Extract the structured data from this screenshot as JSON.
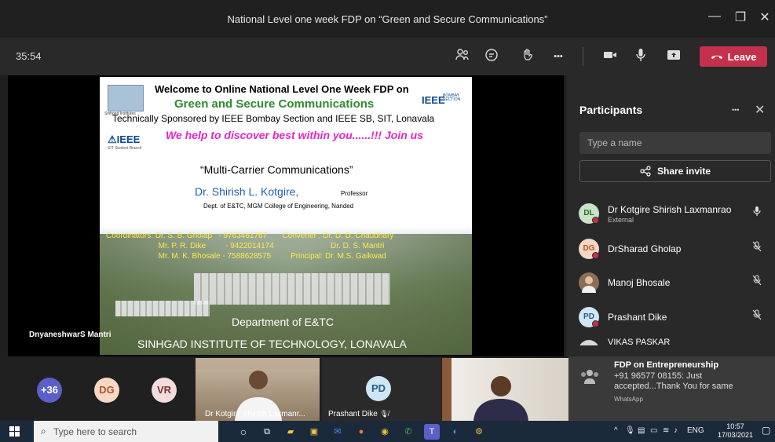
{
  "window": {
    "title": "National Level one week FDP on “Green and Secure Communications”",
    "minimize_glyph": "—",
    "maximize_glyph": "❐",
    "close_glyph": "✕"
  },
  "toolbar": {
    "timer": "35:54",
    "leave_label": "Leave",
    "more_glyph": "•••"
  },
  "slide": {
    "welcome": "Welcome to Online National Level One Week FDP on",
    "green_secure": "Green and Secure Communications",
    "sponsor": "Technically Sponsored by IEEE Bombay Section and IEEE SB, SIT, Lonavala",
    "tagline": "We help to discover best within you......!!!  Join us",
    "talk_title": "“Multi-Carrier Communications”",
    "speaker": "Dr. Shirish L. Kotgire,",
    "speaker_role": "Professor",
    "speaker_dept": "Dept. of E&TC, MGM College of Engineering, Nanded",
    "coordinators_line1": "Coordinators: Dr. S. B. Gholap   - 9763461767       Convener : Dr. D. D. Chaudhary",
    "coordinators_line2": "                        Mr. P. R. Dike         - 9422014174                          Dr. D. S. Mantri",
    "coordinators_line3": "                        Mr. M. K. Bhosale - 7588628575         Principal: Dr. M.S. Gaikwad",
    "department": "Department of E&TC",
    "institute": "SINHGAD  INSTITUTE OF TECHNOLOGY, LONAVALA",
    "logo_caption": "Sinhgad Institutes",
    "ieee_left": "IEEE",
    "ieee_left_caption": "SIT Student Branch",
    "ieee_right": "IEEE",
    "ieee_right_sub1": "BOMBAY",
    "ieee_right_sub2": "SECTION"
  },
  "stage": {
    "presenter_name": "DnyaneshwarS Mantri"
  },
  "participants": {
    "title": "Participants",
    "more_glyph": "•••",
    "close_glyph": "✕",
    "search_placeholder": "Type a name",
    "share_label": "Share invite",
    "list": [
      {
        "initials": "DL",
        "name": "Dr Kotgire Shirish Laxmanrao",
        "sub": "External",
        "avatar_color": "#c9e3c6",
        "initials_color": "#2f6b2a",
        "mic": "on"
      },
      {
        "initials": "DG",
        "name": "DrSharad Gholap",
        "sub": "",
        "avatar_color": "#f5d7c6",
        "initials_color": "#b1552a",
        "mic": "off"
      },
      {
        "initials": "",
        "name": "Manoj Bhosale",
        "sub": "",
        "avatar_color": "#8a6e56",
        "initials_color": "#ffffff",
        "mic": "off"
      },
      {
        "initials": "PD",
        "name": "Prashant Dike",
        "sub": "",
        "avatar_color": "#cfe6f5",
        "initials_color": "#2b5d86",
        "mic": "off"
      },
      {
        "initials": "",
        "name": "VIKAS PASKAR",
        "sub": "",
        "avatar_color": "#d7d7d7",
        "initials_color": "#444444",
        "mic": "off"
      }
    ]
  },
  "notification": {
    "title": "FDP on Entrepreneurship",
    "message": "+91 96577 08155: Just accepted...Thank You for same",
    "app": "WhatsApp"
  },
  "gallery": {
    "overflow_count": "+36",
    "avatars": [
      {
        "initials": "DG",
        "bg": "#f5d7c6",
        "fg": "#b1552a"
      },
      {
        "initials": "VR",
        "bg": "#f2dcdc",
        "fg": "#7a2f2f"
      }
    ],
    "tiles": [
      {
        "label": "Dr Kotgire Shirish Laxmanr..."
      },
      {
        "label": "Prashant Dike",
        "initials": "PD"
      }
    ]
  },
  "taskbar": {
    "search_placeholder": "Type here to search",
    "language": "ENG",
    "time": "10:57",
    "date": "17/03/2021"
  }
}
